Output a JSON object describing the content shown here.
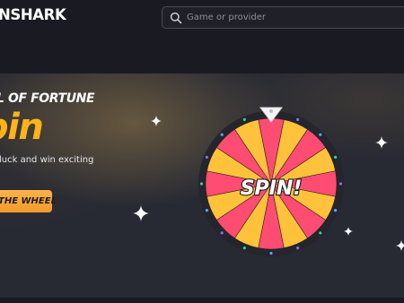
{
  "header": {
    "logo_text": "NSHARK",
    "search": {
      "placeholder": "Game or provider",
      "icon": "search-icon"
    }
  },
  "hero": {
    "kicker": "L OF FORTUNE",
    "headline": "pin",
    "subtext": "luck and win exciting",
    "cta_label": "THE WHEEL",
    "wheel": {
      "center_label": "SPIN!",
      "segment_count": 16,
      "segment_colors": [
        "#ff4c72",
        "#ffc23a"
      ],
      "rim_color": "#25252d",
      "pointer_icon": "pointer-icon",
      "light_colors": [
        "#37d38f",
        "#8e6df5",
        "#59a7ff"
      ]
    },
    "sparkles": [
      "sparkle-icon",
      "sparkle-icon",
      "sparkle-icon",
      "sparkle-icon",
      "sparkle-icon"
    ]
  },
  "colors": {
    "background": "#1c1d24",
    "topbar": "#1a1b22",
    "hero": "#272933",
    "accent": "#ffb31a",
    "button": "#f7a53a"
  }
}
